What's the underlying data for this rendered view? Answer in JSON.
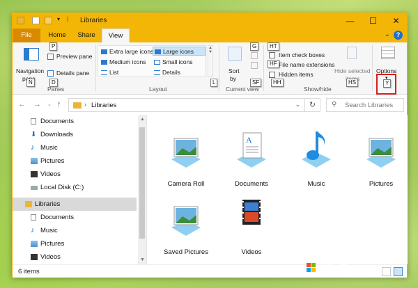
{
  "window": {
    "title": "Libraries"
  },
  "titlebar": {
    "minimize": "—",
    "maximize": "☐",
    "close": "✕"
  },
  "tabs": {
    "file": "File",
    "home": "Home",
    "share": "Share",
    "view": "View"
  },
  "help": "?",
  "ribbon": {
    "navigation_pane": "Navigation",
    "navigation_pane_line2": "pane",
    "preview_pane": "Preview pane",
    "details_pane": "Details pane",
    "panes_group": "Panes",
    "layout": {
      "extra_large": "Extra large icons",
      "large": "Large icons",
      "medium": "Medium icons",
      "small": "Small icons",
      "list": "List",
      "details": "Details"
    },
    "layout_group": "Layout",
    "sort_by": "Sort",
    "sort_by_line2": "by",
    "current_view_group": "Current view",
    "item_check_boxes": "Item check boxes",
    "file_name_extensions": "File name extensions",
    "hidden_items": "Hidden items",
    "hide_selected": "Hide selected",
    "hide_selected_line2": "items",
    "showhide_group": "Show/hide",
    "options": "Options"
  },
  "keytips": {
    "p": "P",
    "n": "N",
    "d": "D",
    "g": "G",
    "ht": "HT",
    "hf": "HF",
    "hh": "HH",
    "hs": "HS",
    "sf": "SF",
    "l": "L",
    "y": "Y"
  },
  "address": {
    "path": "Libraries",
    "search_placeholder": "Search Libraries"
  },
  "navpane": {
    "items": [
      {
        "label": "Documents"
      },
      {
        "label": "Downloads"
      },
      {
        "label": "Music"
      },
      {
        "label": "Pictures"
      },
      {
        "label": "Videos"
      },
      {
        "label": "Local Disk (C:)"
      },
      {
        "label": "Libraries"
      },
      {
        "label": "Documents"
      },
      {
        "label": "Music"
      },
      {
        "label": "Pictures"
      },
      {
        "label": "Videos"
      }
    ]
  },
  "content": {
    "items": [
      {
        "label": "Camera Roll"
      },
      {
        "label": "Documents"
      },
      {
        "label": "Music"
      },
      {
        "label": "Pictures"
      },
      {
        "label": "Saved Pictures"
      },
      {
        "label": "Videos"
      }
    ]
  },
  "status": {
    "count": "6 items"
  },
  "watermark": "WinBuzzer",
  "colors": {
    "titlebar": "#f3b606",
    "file_tab": "#d98a00",
    "selection": "#cce4f7",
    "highlight_box": "#d02020"
  }
}
